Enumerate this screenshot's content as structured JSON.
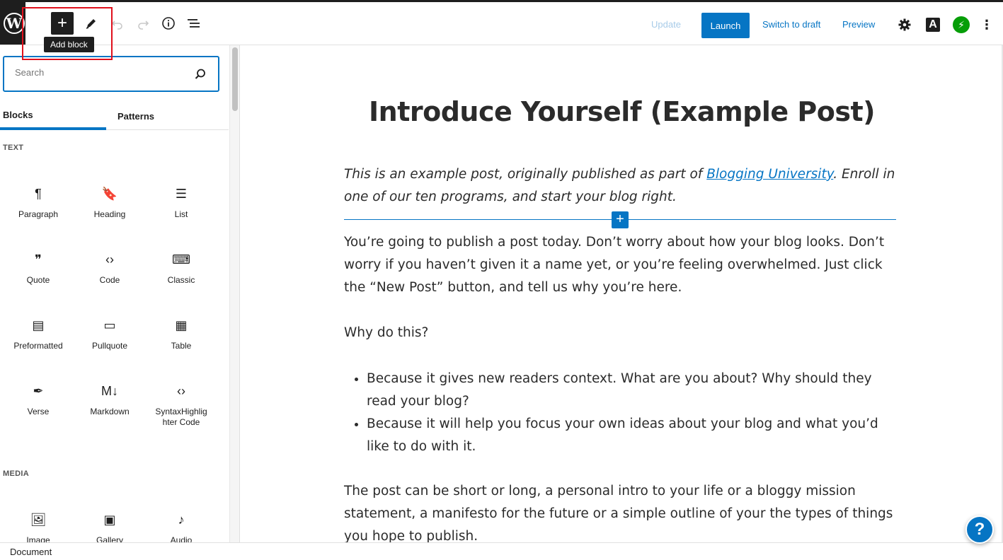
{
  "toolbar": {
    "add_block_tooltip": "Add block",
    "update_label": "Update",
    "launch_label": "Launch",
    "switch_to_draft_label": "Switch to draft",
    "preview_label": "Preview",
    "a_icon_label": "A"
  },
  "sidebar": {
    "search_placeholder": "Search",
    "tabs": [
      {
        "label": "Blocks",
        "active": true
      },
      {
        "label": "Patterns",
        "active": false
      }
    ],
    "text_section_title": "TEXT",
    "text_blocks": [
      {
        "label": "Paragraph",
        "icon": "paragraph-icon",
        "glyph": "¶"
      },
      {
        "label": "Heading",
        "icon": "heading-icon",
        "glyph": "🔖"
      },
      {
        "label": "List",
        "icon": "list-icon",
        "glyph": "☰"
      },
      {
        "label": "Quote",
        "icon": "quote-icon",
        "glyph": "❞"
      },
      {
        "label": "Code",
        "icon": "code-icon",
        "glyph": "‹›"
      },
      {
        "label": "Classic",
        "icon": "keyboard-icon",
        "glyph": "⌨"
      },
      {
        "label": "Preformatted",
        "icon": "preformatted-icon",
        "glyph": "▤"
      },
      {
        "label": "Pullquote",
        "icon": "pullquote-icon",
        "glyph": "▭"
      },
      {
        "label": "Table",
        "icon": "table-icon",
        "glyph": "▦"
      },
      {
        "label": "Verse",
        "icon": "verse-icon",
        "glyph": "✒"
      },
      {
        "label": "Markdown",
        "icon": "markdown-icon",
        "glyph": "M↓"
      },
      {
        "label": "SyntaxHighlighter Code",
        "icon": "syntax-code-icon",
        "glyph": "‹›"
      }
    ],
    "media_section_title": "MEDIA",
    "media_blocks": [
      {
        "label": "Image",
        "icon": "image-icon",
        "glyph": "🖼"
      },
      {
        "label": "Gallery",
        "icon": "gallery-icon",
        "glyph": "▣"
      },
      {
        "label": "Audio",
        "icon": "audio-icon",
        "glyph": "♪"
      }
    ]
  },
  "post": {
    "title": "Introduce Yourself (Example Post)",
    "intro_before_link": "This is an example post, originally published as part of ",
    "intro_link": "Blogging University",
    "intro_after_link": ". Enroll in one of our ten programs, and start your blog right.",
    "paragraph1": "You’re going to publish a post today. Don’t worry about how your blog looks. Don’t worry if you haven’t given it a name yet, or you’re feeling overwhelmed. Just click the “New Post” button, and tell us why you’re here.",
    "paragraph2": "Why do this?",
    "list_items": [
      "Because it gives new readers context. What are you about? Why should they read your blog?",
      "Because it will help you focus your own ideas about your blog and what you’d like to do with it."
    ],
    "paragraph3": "The post can be short or long, a personal intro to your life or a bloggy mission statement, a manifesto for the future or a simple outline of your the types of things you hope to publish."
  },
  "footer": {
    "breadcrumb": "Document"
  },
  "help": {
    "label": "?"
  },
  "colors": {
    "accent": "#0675c4",
    "highlight": "#e0101c",
    "jetpack": "#069e08"
  }
}
